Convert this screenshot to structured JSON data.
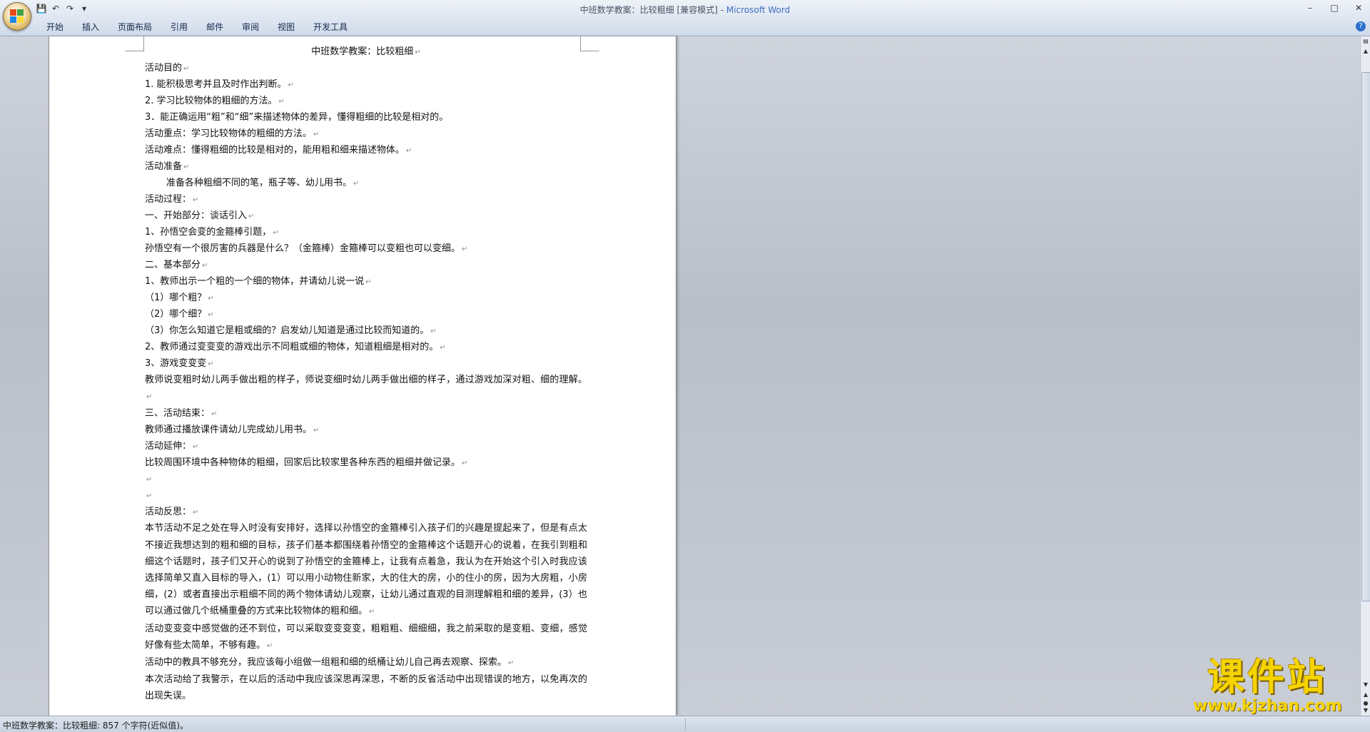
{
  "window": {
    "title": "中班数学教案：比较粗细 [兼容模式] - ",
    "app_name": "Microsoft Word"
  },
  "ribbon": {
    "tabs": [
      "开始",
      "插入",
      "页面布局",
      "引用",
      "邮件",
      "审阅",
      "视图",
      "开发工具"
    ]
  },
  "document": {
    "title": "中班数学教案：比较粗细",
    "lines": [
      "活动目的",
      " 1. 能积极思考并且及时作出判断。",
      " 2. 学习比较物体的粗细的方法。",
      " 3．能正确运用“粗”和“细”来描述物体的差异，懂得粗细的比较是相对的。",
      "活动重点：学习比较物体的粗细的方法。",
      "活动难点：懂得粗细的比较是相对的，能用粗和细来描述物体。",
      "活动准备",
      "准备各种粗细不同的笔，瓶子等、幼儿用书。",
      "活动过程：",
      "一、开始部分：谈话引入",
      "1、孙悟空会变的金箍棒引题，",
      "孙悟空有一个很厉害的兵器是什么？（金箍棒）金箍棒可以变粗也可以变细。",
      "二、基本部分",
      "1、教师出示一个粗的一个细的物体，并请幼儿说一说",
      "（1）哪个粗？",
      "（2）哪个细？",
      "（3）你怎么知道它是粗或细的？启发幼儿知道是通过比较而知道的。",
      "2、教师通过变变变的游戏出示不同粗或细的物体，知道粗细是相对的。",
      "3、游戏变变变"
    ],
    "para_game": "教师说变粗时幼儿两手做出粗的样子，师说变细时幼儿两手做出细的样子，通过游戏加深对粗、细的理解。",
    "lines2": [
      "三、活动结束：",
      "教师通过播放课件请幼儿完成幼儿用书。",
      "活动延伸：",
      "比较周围环境中各种物体的粗细，回家后比较家里各种东西的粗细并做记录。",
      "",
      "",
      "活动反思："
    ],
    "reflection_1": "本节活动不足之处在导入时没有安排好，选择以孙悟空的金箍棒引入孩子们的兴趣是提起来了，但是有点太不接近我想达到的粗和细的目标，孩子们基本都围绕着孙悟空的金箍棒这个话题开心的说着，在我引到粗和细这个话题时，孩子们又开心的说到了孙悟空的金箍棒上，让我有点着急，我认为在开始这个引入时我应该选择简单又直入目标的导入，(1）可以用小动物住新家，大的住大的房，小的住小的房，因为大房粗，小房细，(2）或者直接出示粗细不同的两个物体请幼儿观察，让幼儿通过直观的目测理解粗和细的差异，(3）也可以通过做几个纸桶重叠的方式来比较物体的粗和细。",
    "reflection_2": "活动变变变中感觉做的还不到位，可以采取变变变变，粗粗粗、细细细，我之前采取的是变粗、变细，感觉好像有些太简单，不够有趣。",
    "reflection_3": "活动中的教具不够充分，我应该每小组做一组粗和细的纸桶让幼儿自己再去观察、探索。",
    "reflection_4": "本次活动给了我警示，在以后的活动中我应该深思再深思，不断的反省活动中出现错误的地方，以免再次的出现失误。"
  },
  "status": {
    "text": "中班数学教案：比较粗细: 857 个字符(近似值)。"
  },
  "watermark": {
    "name": "课件站",
    "url": "www.kjzhan.com"
  }
}
